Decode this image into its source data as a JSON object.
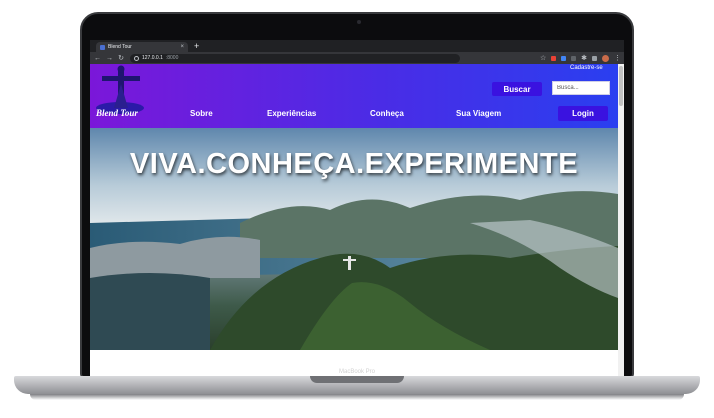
{
  "browser": {
    "tab_title": "Blend Tour",
    "new_tab_glyph": "+",
    "tab_close_glyph": "×",
    "url_host": "127.0.0.1",
    "url_port": ":8000"
  },
  "header": {
    "logo_icon": "christ-redeemer-logo-icon",
    "logo_text": "Blend Tour",
    "signup_link": "Cadastre-se",
    "search_button": "Buscar",
    "search_placeholder": "Busca...",
    "login_button": "Login",
    "nav": [
      "Sobre",
      "Experiências",
      "Conheça",
      "Sua Viagem"
    ]
  },
  "hero": {
    "title": "VIVA.CONHEÇA.EXPERIMENTE"
  },
  "device": {
    "model_label": "MacBook Pro"
  },
  "colors": {
    "header_gradient_start": "#7b17d9",
    "header_gradient_end": "#2a3ff0",
    "button_bg": "#3a12e0"
  }
}
